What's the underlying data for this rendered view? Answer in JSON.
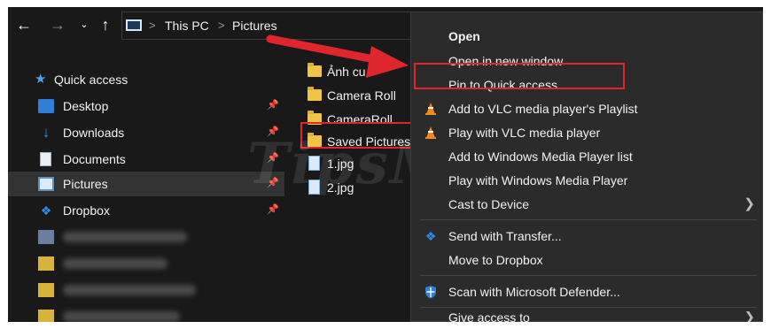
{
  "toolbar": {
    "back_icon": "arrow-left-icon",
    "forward_icon": "arrow-right-icon",
    "recent_icon": "chevron-down-icon",
    "up_icon": "arrow-up-icon"
  },
  "address": {
    "crumbs": [
      "This PC",
      "Pictures"
    ],
    "separator": ">"
  },
  "sidebar": {
    "items": [
      {
        "label": "Quick access",
        "icon": "star-icon"
      },
      {
        "label": "Desktop",
        "icon": "desktop-icon",
        "pinned": true
      },
      {
        "label": "Downloads",
        "icon": "download-icon",
        "pinned": true
      },
      {
        "label": "Documents",
        "icon": "documents-icon",
        "pinned": true
      },
      {
        "label": "Pictures",
        "icon": "pictures-icon",
        "pinned": true,
        "selected": true
      },
      {
        "label": "Dropbox",
        "icon": "dropbox-icon",
        "pinned": true
      }
    ],
    "blurred_count": 4
  },
  "files": {
    "items": [
      {
        "label": "Ảnh cu",
        "type": "folder"
      },
      {
        "label": "Camera Roll",
        "type": "folder"
      },
      {
        "label": "CameraRoll",
        "type": "folder"
      },
      {
        "label": "Saved Pictures",
        "type": "folder",
        "highlighted": true
      },
      {
        "label": "1.jpg",
        "type": "image"
      },
      {
        "label": "2.jpg",
        "type": "image"
      }
    ]
  },
  "context_menu": {
    "items": [
      {
        "label": "Open",
        "bold": true
      },
      {
        "label": "Open in new window"
      },
      {
        "label": "Pin to Quick access",
        "highlighted": true
      },
      {
        "label": "Add to VLC media player's Playlist",
        "icon": "vlc-cone-icon"
      },
      {
        "label": "Play with VLC media player",
        "icon": "vlc-cone-icon"
      },
      {
        "label": "Add to Windows Media Player list"
      },
      {
        "label": "Play with Windows Media Player"
      },
      {
        "label": "Cast to Device",
        "submenu": true
      },
      {
        "label": "Send with Transfer...",
        "icon": "dropbox-icon"
      },
      {
        "label": "Move to Dropbox"
      },
      {
        "label": "Scan with Microsoft Defender...",
        "icon": "defender-shield-icon"
      },
      {
        "label": "Give access to",
        "submenu": true
      }
    ]
  },
  "watermark": "TipsMake",
  "colors": {
    "background": "#191919",
    "menu_background": "#2b2b2b",
    "highlight_border": "#e0262d",
    "arrow": "#e0262d",
    "folder": "#f0c445",
    "selected_row": "#333333"
  }
}
